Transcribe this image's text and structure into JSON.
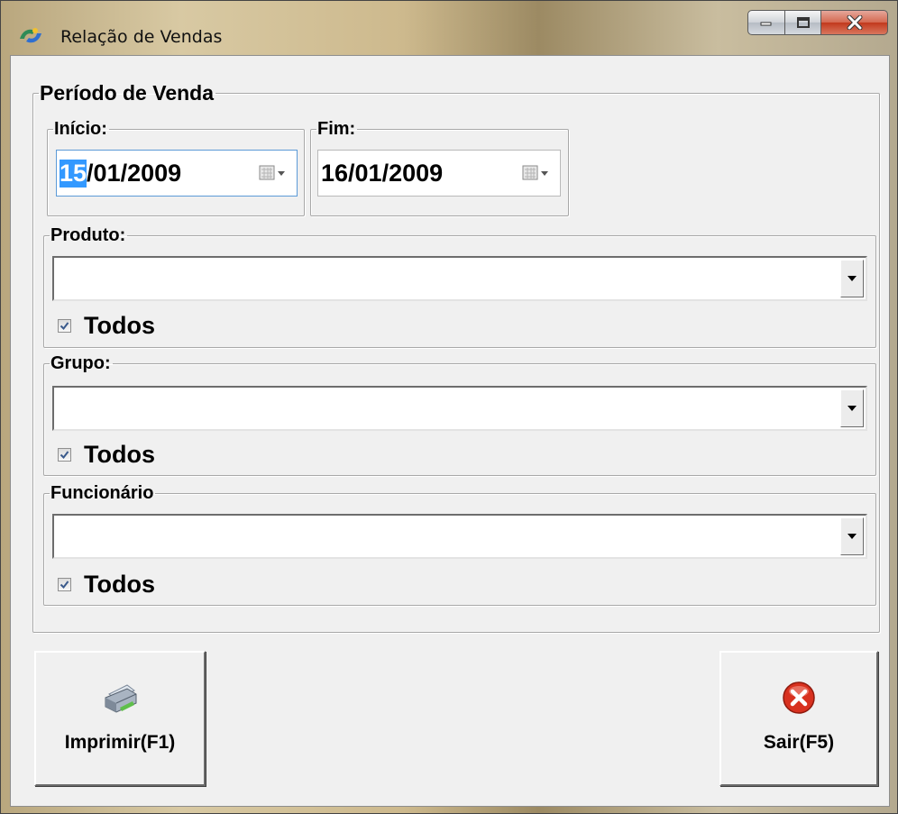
{
  "window": {
    "title": "Relação de Vendas"
  },
  "periodo": {
    "legend": "Período de Venda",
    "inicio": {
      "label": "Início:",
      "selected_part": "15",
      "rest": "/01/2009"
    },
    "fim": {
      "label": "Fim:",
      "value": "16/01/2009"
    }
  },
  "produto": {
    "label": "Produto:",
    "value": "",
    "todos_label": "Todos",
    "todos_checked": true
  },
  "grupo": {
    "label": "Grupo:",
    "value": "",
    "todos_label": "Todos",
    "todos_checked": true
  },
  "funcionario": {
    "label": "Funcionário",
    "value": "",
    "todos_label": "Todos",
    "todos_checked": true
  },
  "buttons": {
    "print": "Imprimir(F1)",
    "exit": "Sair(F5)"
  },
  "colors": {
    "selection": "#3399ff",
    "close_button": "#c2391d",
    "client_bg": "#f0f0f0"
  }
}
